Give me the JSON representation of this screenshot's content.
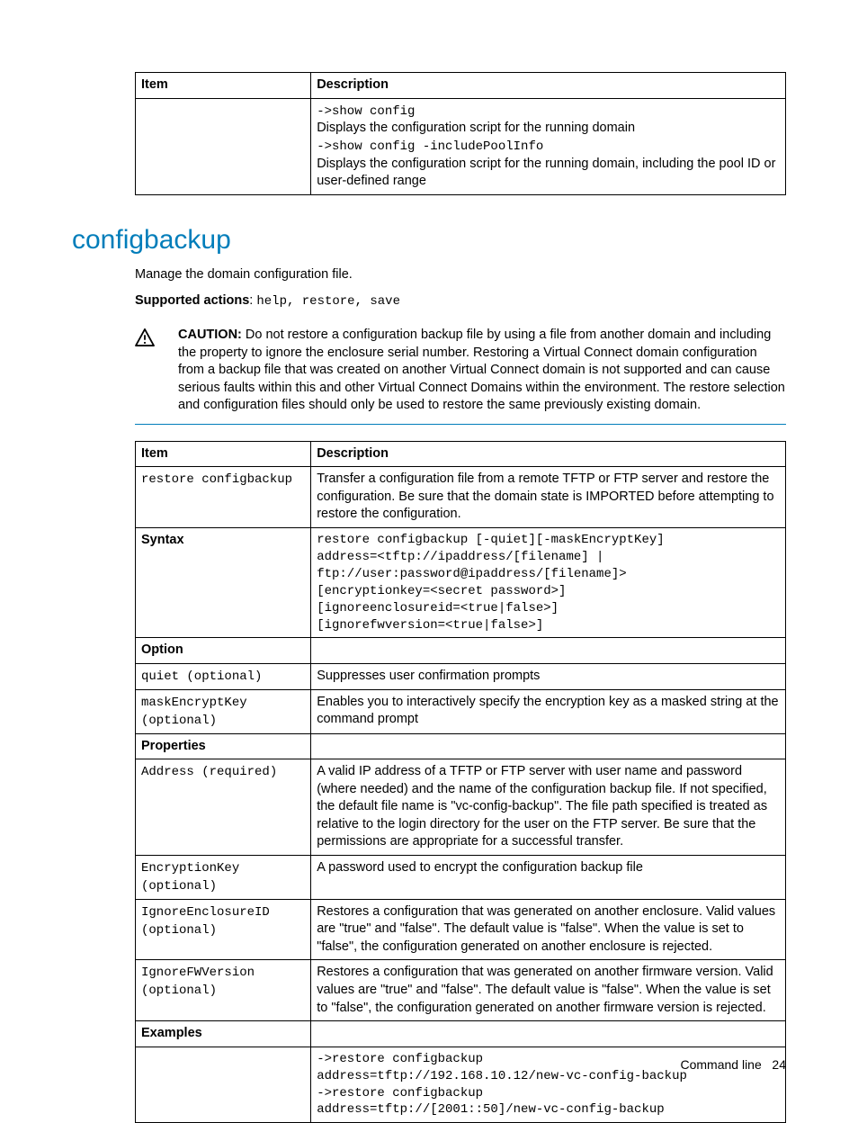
{
  "table1": {
    "head_item": "Item",
    "head_desc": "Description",
    "row1_item": "",
    "row1_cmd1": "->show config",
    "row1_txt1": "Displays the configuration script for the running domain",
    "row1_cmd2": "->show config -includePoolInfo",
    "row1_txt2": "Displays the configuration script for the running domain, including the pool ID or user-defined range"
  },
  "section_title": "configbackup",
  "intro": "Manage the domain configuration file.",
  "supported_label": "Supported actions",
  "supported_sep": ": ",
  "supported_actions": "help, restore, save",
  "caution_label": "CAUTION:",
  "caution_body": "   Do not restore a configuration backup file by using a file from another domain and including the property to ignore the enclosure serial number. Restoring a Virtual Connect domain configuration from a backup file that was created on another Virtual Connect domain is not supported and can cause serious faults within this and other Virtual Connect Domains within the environment. The restore selection and configuration files should only be used to restore the same previously existing domain.",
  "table2": {
    "head_item": "Item",
    "head_desc": "Description",
    "rows": [
      {
        "item_mono": "restore configbackup",
        "item_plain": "",
        "item_bold": "",
        "desc_plain": "Transfer a configuration file from a remote TFTP or FTP server and restore the configuration. Be sure that the domain state is IMPORTED before attempting to restore the configuration.",
        "desc_mono_lines": []
      },
      {
        "item_mono": "",
        "item_plain": "",
        "item_bold": "Syntax",
        "desc_plain": "",
        "desc_mono_lines": [
          "restore configbackup [-quiet][-maskEncryptKey]",
          "address=<tftp://ipaddress/[filename] |",
          "ftp://user:password@ipaddress/[filename]>",
          "[encryptionkey=<secret password>]",
          "[ignoreenclosureid=<true|false>]",
          "[ignorefwversion=<true|false>]"
        ]
      },
      {
        "item_mono": "",
        "item_plain": "",
        "item_bold": "Option",
        "desc_plain": "",
        "desc_mono_lines": []
      },
      {
        "item_mono": "quiet (optional)",
        "item_plain": "",
        "item_bold": "",
        "desc_plain": "Suppresses user confirmation prompts",
        "desc_mono_lines": []
      },
      {
        "item_mono": "maskEncryptKey (optional)",
        "item_plain": "",
        "item_bold": "",
        "desc_plain": "Enables you to interactively specify the encryption key as a masked string at the command prompt",
        "desc_mono_lines": []
      },
      {
        "item_mono": "",
        "item_plain": "",
        "item_bold": "Properties",
        "desc_plain": "",
        "desc_mono_lines": []
      },
      {
        "item_mono": "Address (required)",
        "item_plain": "",
        "item_bold": "",
        "desc_plain": "A valid IP address of a TFTP or FTP server with user name and password (where needed) and the name of the configuration backup file. If not specified, the default file name is \"vc-config-backup\". The file path specified is treated as relative to the login directory for the user on the FTP server. Be sure that the permissions are appropriate for a successful transfer.",
        "desc_mono_lines": []
      },
      {
        "item_mono": "EncryptionKey (optional)",
        "item_plain": "",
        "item_bold": "",
        "desc_plain": "A password used to encrypt the configuration backup file",
        "desc_mono_lines": []
      },
      {
        "item_mono": "IgnoreEnclosureID (optional)",
        "item_plain": "",
        "item_bold": "",
        "desc_plain": "Restores a configuration that was generated on another enclosure. Valid values are \"true\" and \"false\". The default value is \"false\". When the value is set to \"false\", the configuration generated on another enclosure is rejected.",
        "desc_mono_lines": []
      },
      {
        "item_mono": "IgnoreFWVersion (optional)",
        "item_plain": "",
        "item_bold": "",
        "desc_plain": "Restores a configuration that was generated on another firmware version. Valid values are \"true\" and \"false\". The default value is \"false\". When the value is set to \"false\", the configuration generated on another firmware version is rejected.",
        "desc_mono_lines": []
      },
      {
        "item_mono": "",
        "item_plain": "",
        "item_bold": "Examples",
        "desc_plain": "",
        "desc_mono_lines": []
      },
      {
        "item_mono": "",
        "item_plain": "",
        "item_bold": "",
        "desc_plain": "",
        "desc_mono_lines": [
          "->restore configbackup",
          "address=tftp://192.168.10.12/new-vc-config-backup",
          "->restore configbackup",
          "address=tftp://[2001::50]/new-vc-config-backup"
        ]
      }
    ]
  },
  "footer_text": "Command line",
  "footer_page": "24"
}
